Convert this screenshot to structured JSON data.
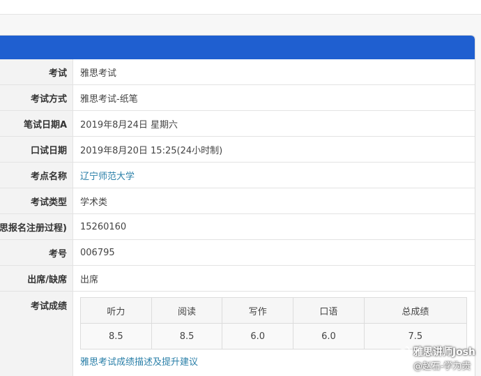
{
  "rows": [
    {
      "label": "考试",
      "value": "雅思考试"
    },
    {
      "label": "考试方式",
      "value": "雅思考试-纸笔"
    },
    {
      "label": "笔试日期A",
      "value": "2019年8月24日 星期六"
    },
    {
      "label": "口试日期",
      "value": "2019年8月20日 15:25(24小时制)"
    },
    {
      "label": "考点名称",
      "value": "辽宁师范大学"
    },
    {
      "label": "考试类型",
      "value": "学术类"
    },
    {
      "label": "思报名注册过程)",
      "value": "15260160"
    },
    {
      "label": "考号",
      "value": "006795"
    },
    {
      "label": "出席/缺席",
      "value": "出席"
    }
  ],
  "scores": {
    "label": "考试成绩",
    "headers": [
      "听力",
      "阅读",
      "写作",
      "口语",
      "总成绩"
    ],
    "values": [
      "8.5",
      "8.5",
      "6.0",
      "6.0",
      "7.5"
    ],
    "link_text": "雅思考试成绩描述及提升建议"
  },
  "watermark": {
    "line1": "雅思讲师Josh",
    "line2": "@赵石-学为贵",
    "icon": "weibo-icon"
  },
  "colors": {
    "header_blue": "#1f5fd0",
    "link_teal": "#2a7fa8"
  }
}
